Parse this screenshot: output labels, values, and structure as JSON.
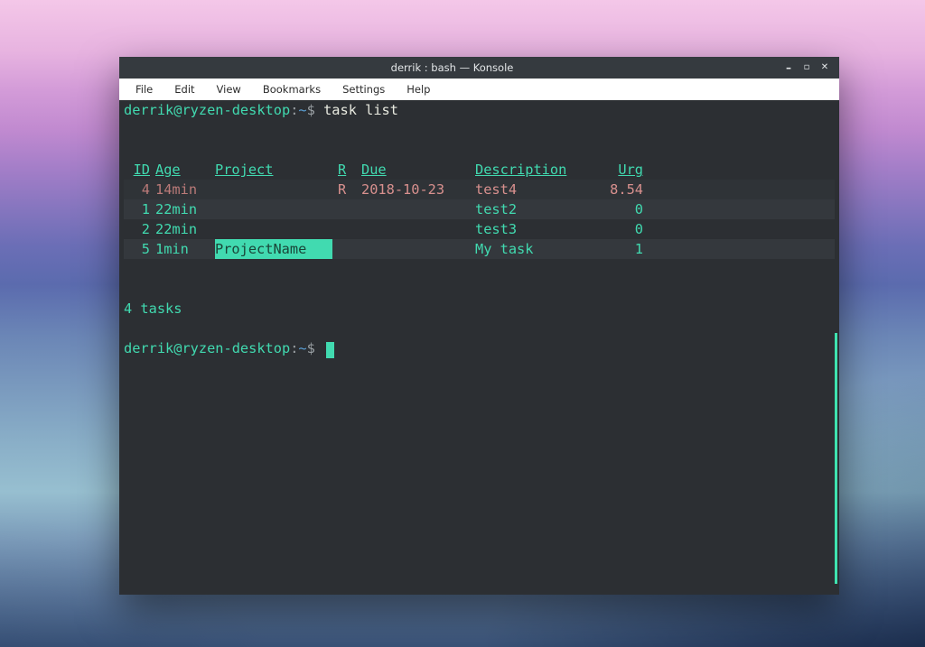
{
  "window": {
    "title": "derrik : bash — Konsole"
  },
  "menu": {
    "items": [
      "File",
      "Edit",
      "View",
      "Bookmarks",
      "Settings",
      "Help"
    ]
  },
  "term": {
    "prompt_user": "derrik@ryzen-desktop",
    "prompt_sep": ":",
    "prompt_path": "~",
    "prompt_sigil": "$",
    "command": "task list",
    "headers": {
      "id": "ID",
      "age": "Age",
      "project": "Project",
      "r": "R",
      "due": "Due",
      "desc": "Description",
      "urg": "Urg"
    },
    "rows": [
      {
        "id": "4",
        "age": "14min",
        "project": "",
        "r": "R",
        "due": "2018-10-23",
        "desc": "test4",
        "urg": "8.54",
        "highlight": false,
        "bg": "dim",
        "pink": true
      },
      {
        "id": "1",
        "age": "22min",
        "project": "",
        "r": "",
        "due": "",
        "desc": "test2",
        "urg": "0",
        "highlight": false,
        "bg": "row",
        "pink": false
      },
      {
        "id": "2",
        "age": "22min",
        "project": "",
        "r": "",
        "due": "",
        "desc": "test3",
        "urg": "0",
        "highlight": false,
        "bg": "none",
        "pink": false
      },
      {
        "id": "5",
        "age": "1min",
        "project": "ProjectName",
        "r": "",
        "due": "",
        "desc": "My task",
        "urg": "1",
        "highlight": true,
        "bg": "row",
        "pink": false
      }
    ],
    "summary": "4 tasks"
  }
}
